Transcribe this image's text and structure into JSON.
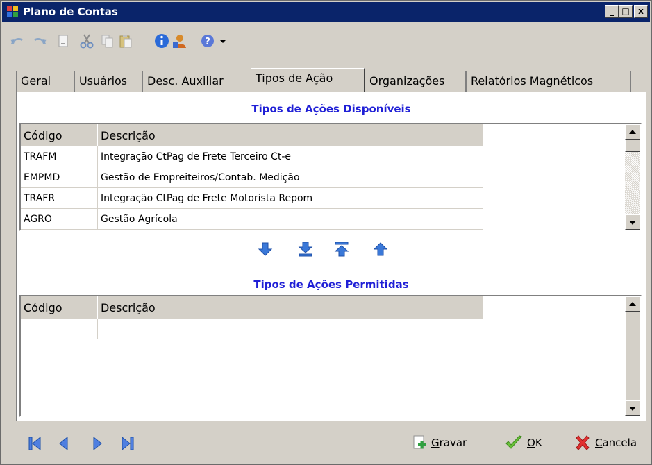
{
  "window": {
    "title": "Plano de Contas",
    "controls": {
      "minimize": "_",
      "maximize": "□",
      "close": "x"
    }
  },
  "toolbar": {
    "icons": [
      "undo-icon",
      "redo-icon",
      "document-icon",
      "cut-icon",
      "copy-icon",
      "paste-icon",
      "info-icon",
      "user-icon",
      "help-icon",
      "dropdown-arrow-icon"
    ]
  },
  "tabs": [
    {
      "label": "Geral"
    },
    {
      "label": "Usuários"
    },
    {
      "label": "Desc. Auxiliar"
    },
    {
      "label": "Tipos de Ação",
      "active": true
    },
    {
      "label": "Organizações"
    },
    {
      "label": "Relatórios Magnéticos"
    }
  ],
  "available": {
    "title": "Tipos de Ações Disponíveis",
    "columns": [
      "Código",
      "Descrição"
    ],
    "rows": [
      {
        "code": "TRAFM",
        "desc": "Integração CtPag de Frete Terceiro Ct-e"
      },
      {
        "code": "EMPMD",
        "desc": "Gestão de Empreiteiros/Contab. Medição"
      },
      {
        "code": "TRAFR",
        "desc": "Integração CtPag de Frete Motorista Repom"
      },
      {
        "code": "AGRO",
        "desc": "Gestão Agrícola"
      }
    ]
  },
  "permitted": {
    "title": "Tipos de Ações Permitidas",
    "columns": [
      "Código",
      "Descrição"
    ],
    "rows": [
      {
        "code": "",
        "desc": ""
      }
    ]
  },
  "move_buttons": [
    "move-down-icon",
    "move-all-down-icon",
    "move-all-up-icon",
    "move-up-icon"
  ],
  "footer": {
    "nav": [
      "first-record-icon",
      "previous-record-icon",
      "next-record-icon",
      "last-record-icon"
    ],
    "save": {
      "mnemonic": "G",
      "rest": "ravar"
    },
    "ok": {
      "mnemonic": "O",
      "rest": "K"
    },
    "cancel": {
      "mnemonic": "C",
      "rest": "ancela"
    }
  },
  "colors": {
    "titlebar": "#0a246a",
    "section_title": "#1f1fd6",
    "nav_arrows": "#2f5fd0"
  }
}
